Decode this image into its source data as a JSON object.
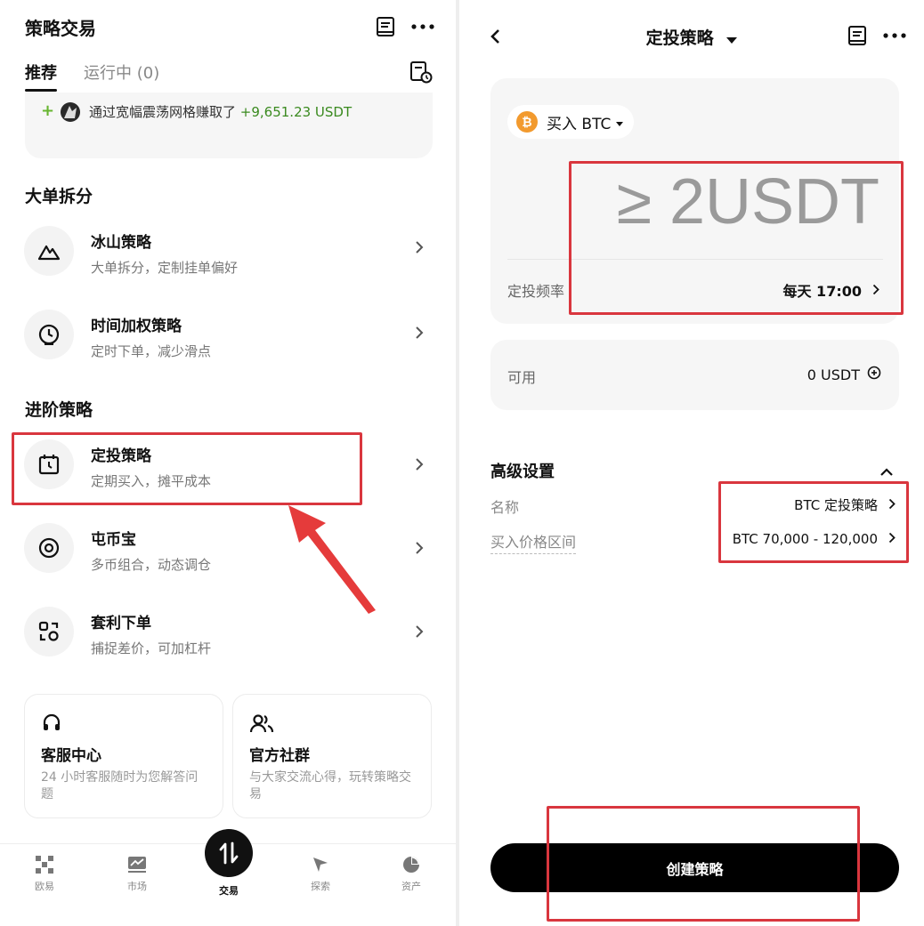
{
  "left": {
    "header": {
      "title": "策略交易"
    },
    "tabs": [
      {
        "label": "推荐"
      },
      {
        "label": "运行中 (0)"
      }
    ],
    "promo": {
      "prefix": "通过宽幅震荡网格赚取了",
      "amount": "+9,651.23 USDT"
    },
    "sections": [
      {
        "title": "大单拆分",
        "items": [
          {
            "title": "冰山策略",
            "desc": "大单拆分，定制挂单偏好",
            "icon": "mountain-icon"
          },
          {
            "title": "时间加权策略",
            "desc": "定时下单，减少滑点",
            "icon": "clock-icon"
          }
        ]
      },
      {
        "title": "进阶策略",
        "items": [
          {
            "title": "定投策略",
            "desc": "定期买入，摊平成本",
            "icon": "calendar-clock-icon"
          },
          {
            "title": "屯币宝",
            "desc": "多币组合，动态调仓",
            "icon": "coin-circle-icon"
          },
          {
            "title": "套利下单",
            "desc": "捕捉差价，可加杠杆",
            "icon": "arbitrage-icon"
          }
        ]
      }
    ],
    "service_cards": [
      {
        "title": "客服中心",
        "desc": "24 小时客服随时为您解答问题",
        "icon": "headset-icon"
      },
      {
        "title": "官方社群",
        "desc": "与大家交流心得，玩转策略交易",
        "icon": "community-icon"
      }
    ],
    "bottom_nav": [
      {
        "label": "欧易",
        "icon": "okx-logo-icon"
      },
      {
        "label": "市场",
        "icon": "chart-icon"
      },
      {
        "label": "交易",
        "icon": "trade-swap-icon"
      },
      {
        "label": "探索",
        "icon": "compass-icon"
      },
      {
        "label": "资产",
        "icon": "pie-icon"
      }
    ]
  },
  "right": {
    "header": {
      "title": "定投策略"
    },
    "asset": {
      "label": "买入 BTC",
      "coin_symbol": "₿"
    },
    "amount": {
      "text": "≥ 2USDT"
    },
    "frequency": {
      "label": "定投频率",
      "value": "每天 17:00"
    },
    "available": {
      "label": "可用",
      "value": "0 USDT"
    },
    "advanced": {
      "title": "高级设置",
      "name": {
        "label": "名称",
        "value": "BTC 定投策略"
      },
      "price_range": {
        "label": "买入价格区间",
        "value": "BTC 70,000 - 120,000"
      }
    },
    "create_button": {
      "label": "创建策略"
    }
  },
  "colors": {
    "accent_green": "#3a8a1f",
    "highlight_red": "#d9363e",
    "btc_orange": "#f29a2e",
    "primary_black": "#000000"
  }
}
